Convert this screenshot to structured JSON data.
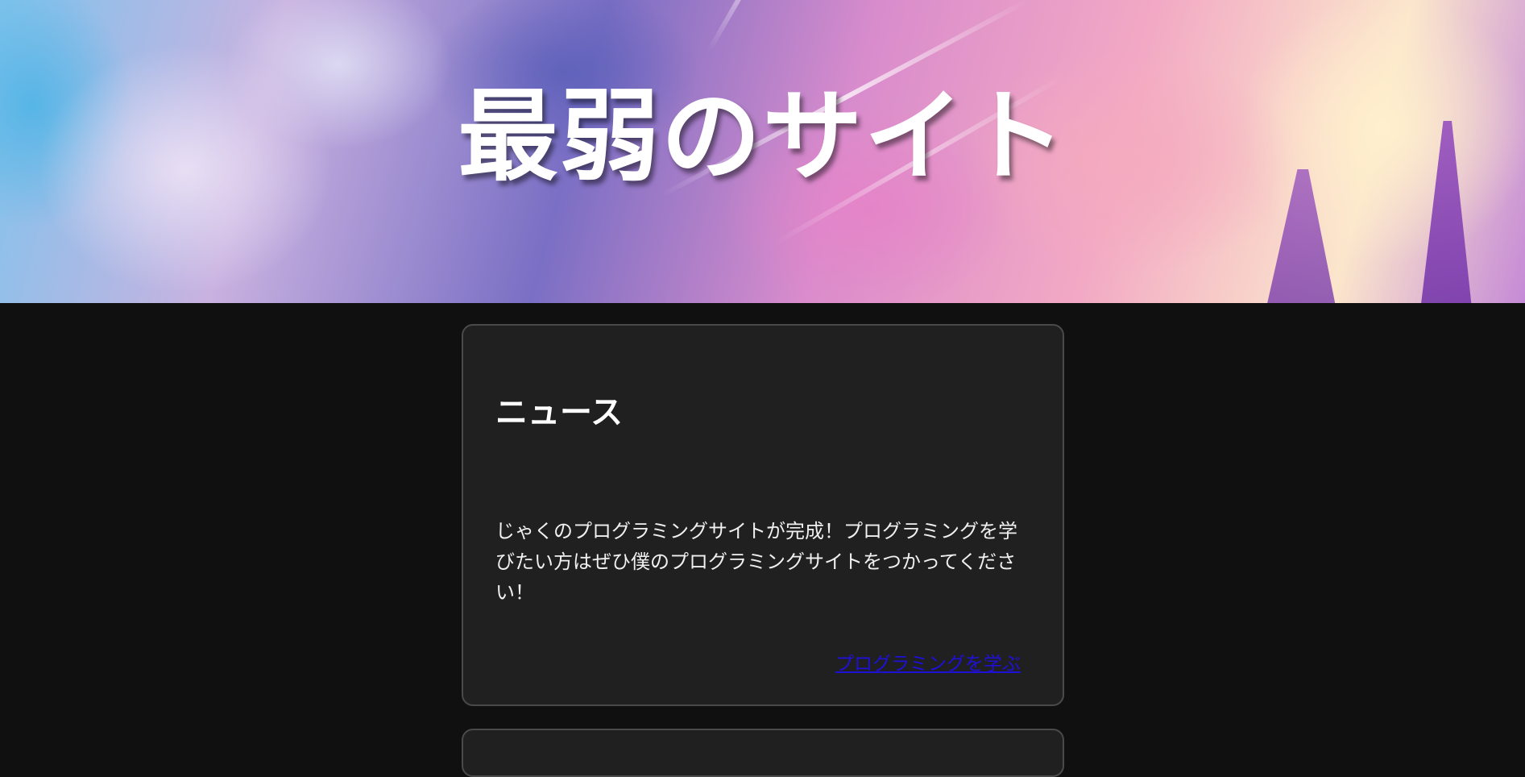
{
  "header": {
    "title": "最弱のサイト"
  },
  "news": {
    "heading": "ニュース",
    "body": "じゃくのプログラミングサイトが完成！プログラミングを学びたい方はぜひ僕のプログラミングサイトをつかってください！",
    "link_label": "プログラミングを学ぶ"
  },
  "colors": {
    "page_background": "#101010",
    "card_background": "#202020",
    "card_border": "#4a4a4a",
    "link": "#1f10d8",
    "title_text": "#ffffff"
  }
}
